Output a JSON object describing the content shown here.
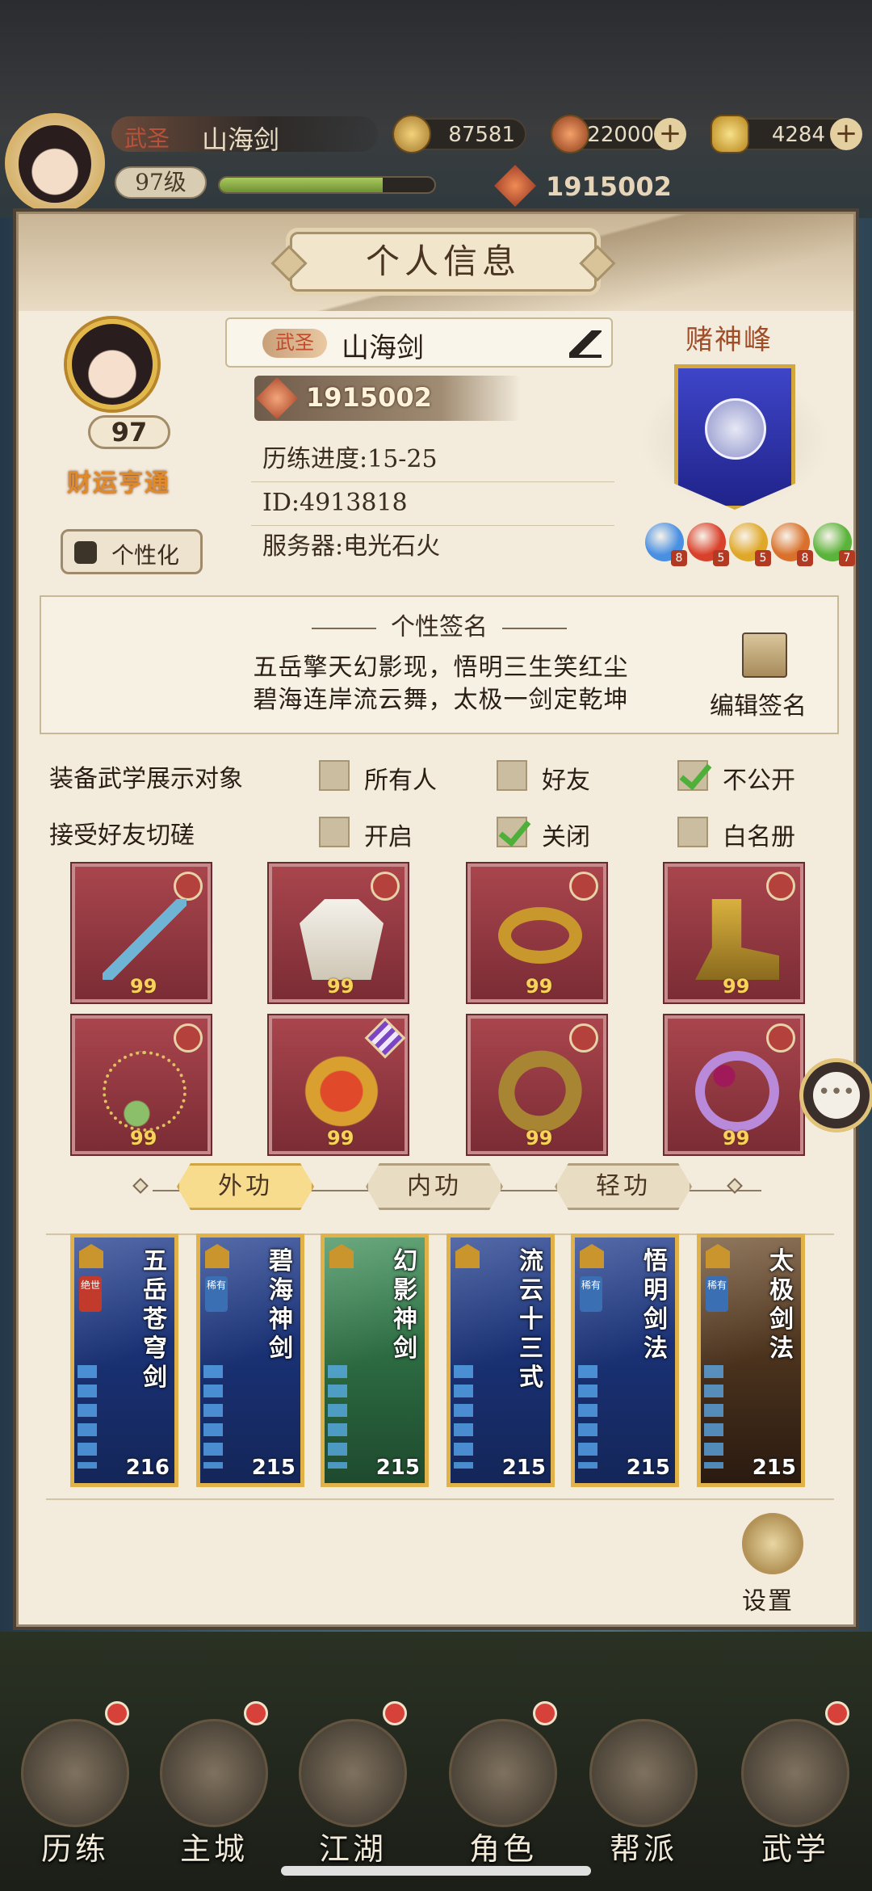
{
  "hud": {
    "rank": "武圣",
    "name": "山海剑",
    "level": "97级",
    "exp_fraction": 0.76,
    "coins": "87581",
    "gems": "22000",
    "ingots": "4284",
    "power": "1915002"
  },
  "panel": {
    "title": "个人信息",
    "profile": {
      "level": "97",
      "title_badge": "财运亨通",
      "customize_label": "个性化",
      "rank": "武圣",
      "name": "山海剑",
      "power": "1915002",
      "progress": "历练进度:15-25",
      "id": "ID:4913818",
      "server": "服务器:电光石火"
    },
    "sect": {
      "name": "赌神峰",
      "orbs": [
        {
          "count": "8",
          "color": "#4a90e2"
        },
        {
          "count": "5",
          "color": "#d9412c"
        },
        {
          "count": "5",
          "color": "#e0a82a"
        },
        {
          "count": "8",
          "color": "#d9712c"
        },
        {
          "count": "7",
          "color": "#5ab33a"
        }
      ]
    },
    "signature": {
      "title": "个性签名",
      "line1": "五岳擎天幻影现，悟明三生笑红尘",
      "line2": "碧海连岸流云舞，太极一剑定乾坤",
      "edit_label": "编辑签名"
    },
    "options": {
      "row1_label": "装备武学展示对象",
      "row1": [
        {
          "label": "所有人",
          "checked": false
        },
        {
          "label": "好友",
          "checked": false
        },
        {
          "label": "不公开",
          "checked": true
        }
      ],
      "row2_label": "接受好友切磋",
      "row2": [
        {
          "label": "开启",
          "checked": false
        },
        {
          "label": "关闭",
          "checked": true
        },
        {
          "label": "白名册",
          "checked": false
        }
      ]
    },
    "equipment": [
      {
        "name": "sword",
        "level": "99"
      },
      {
        "name": "robe",
        "level": "99"
      },
      {
        "name": "belt",
        "level": "99"
      },
      {
        "name": "boots",
        "level": "99"
      },
      {
        "name": "necklace",
        "level": "99"
      },
      {
        "name": "amulet",
        "level": "99"
      },
      {
        "name": "bracelet",
        "level": "99"
      },
      {
        "name": "ring",
        "level": "99"
      }
    ],
    "tabs": [
      "外功",
      "内功",
      "轻功"
    ],
    "skills": [
      {
        "title": "五岳苍穹剑",
        "tag": "绝世",
        "value": "216"
      },
      {
        "title": "碧海神剑",
        "tag": "稀有",
        "value": "215"
      },
      {
        "title": "幻影神剑",
        "tag": "",
        "value": "215"
      },
      {
        "title": "流云十三式",
        "tag": "",
        "value": "215"
      },
      {
        "title": "悟明剑法",
        "tag": "稀有",
        "value": "215"
      },
      {
        "title": "太极剑法",
        "tag": "稀有",
        "value": "215"
      }
    ],
    "settings_label": "设置"
  },
  "nav": [
    "历练",
    "主城",
    "江湖",
    "角色",
    "帮派",
    "武学"
  ]
}
